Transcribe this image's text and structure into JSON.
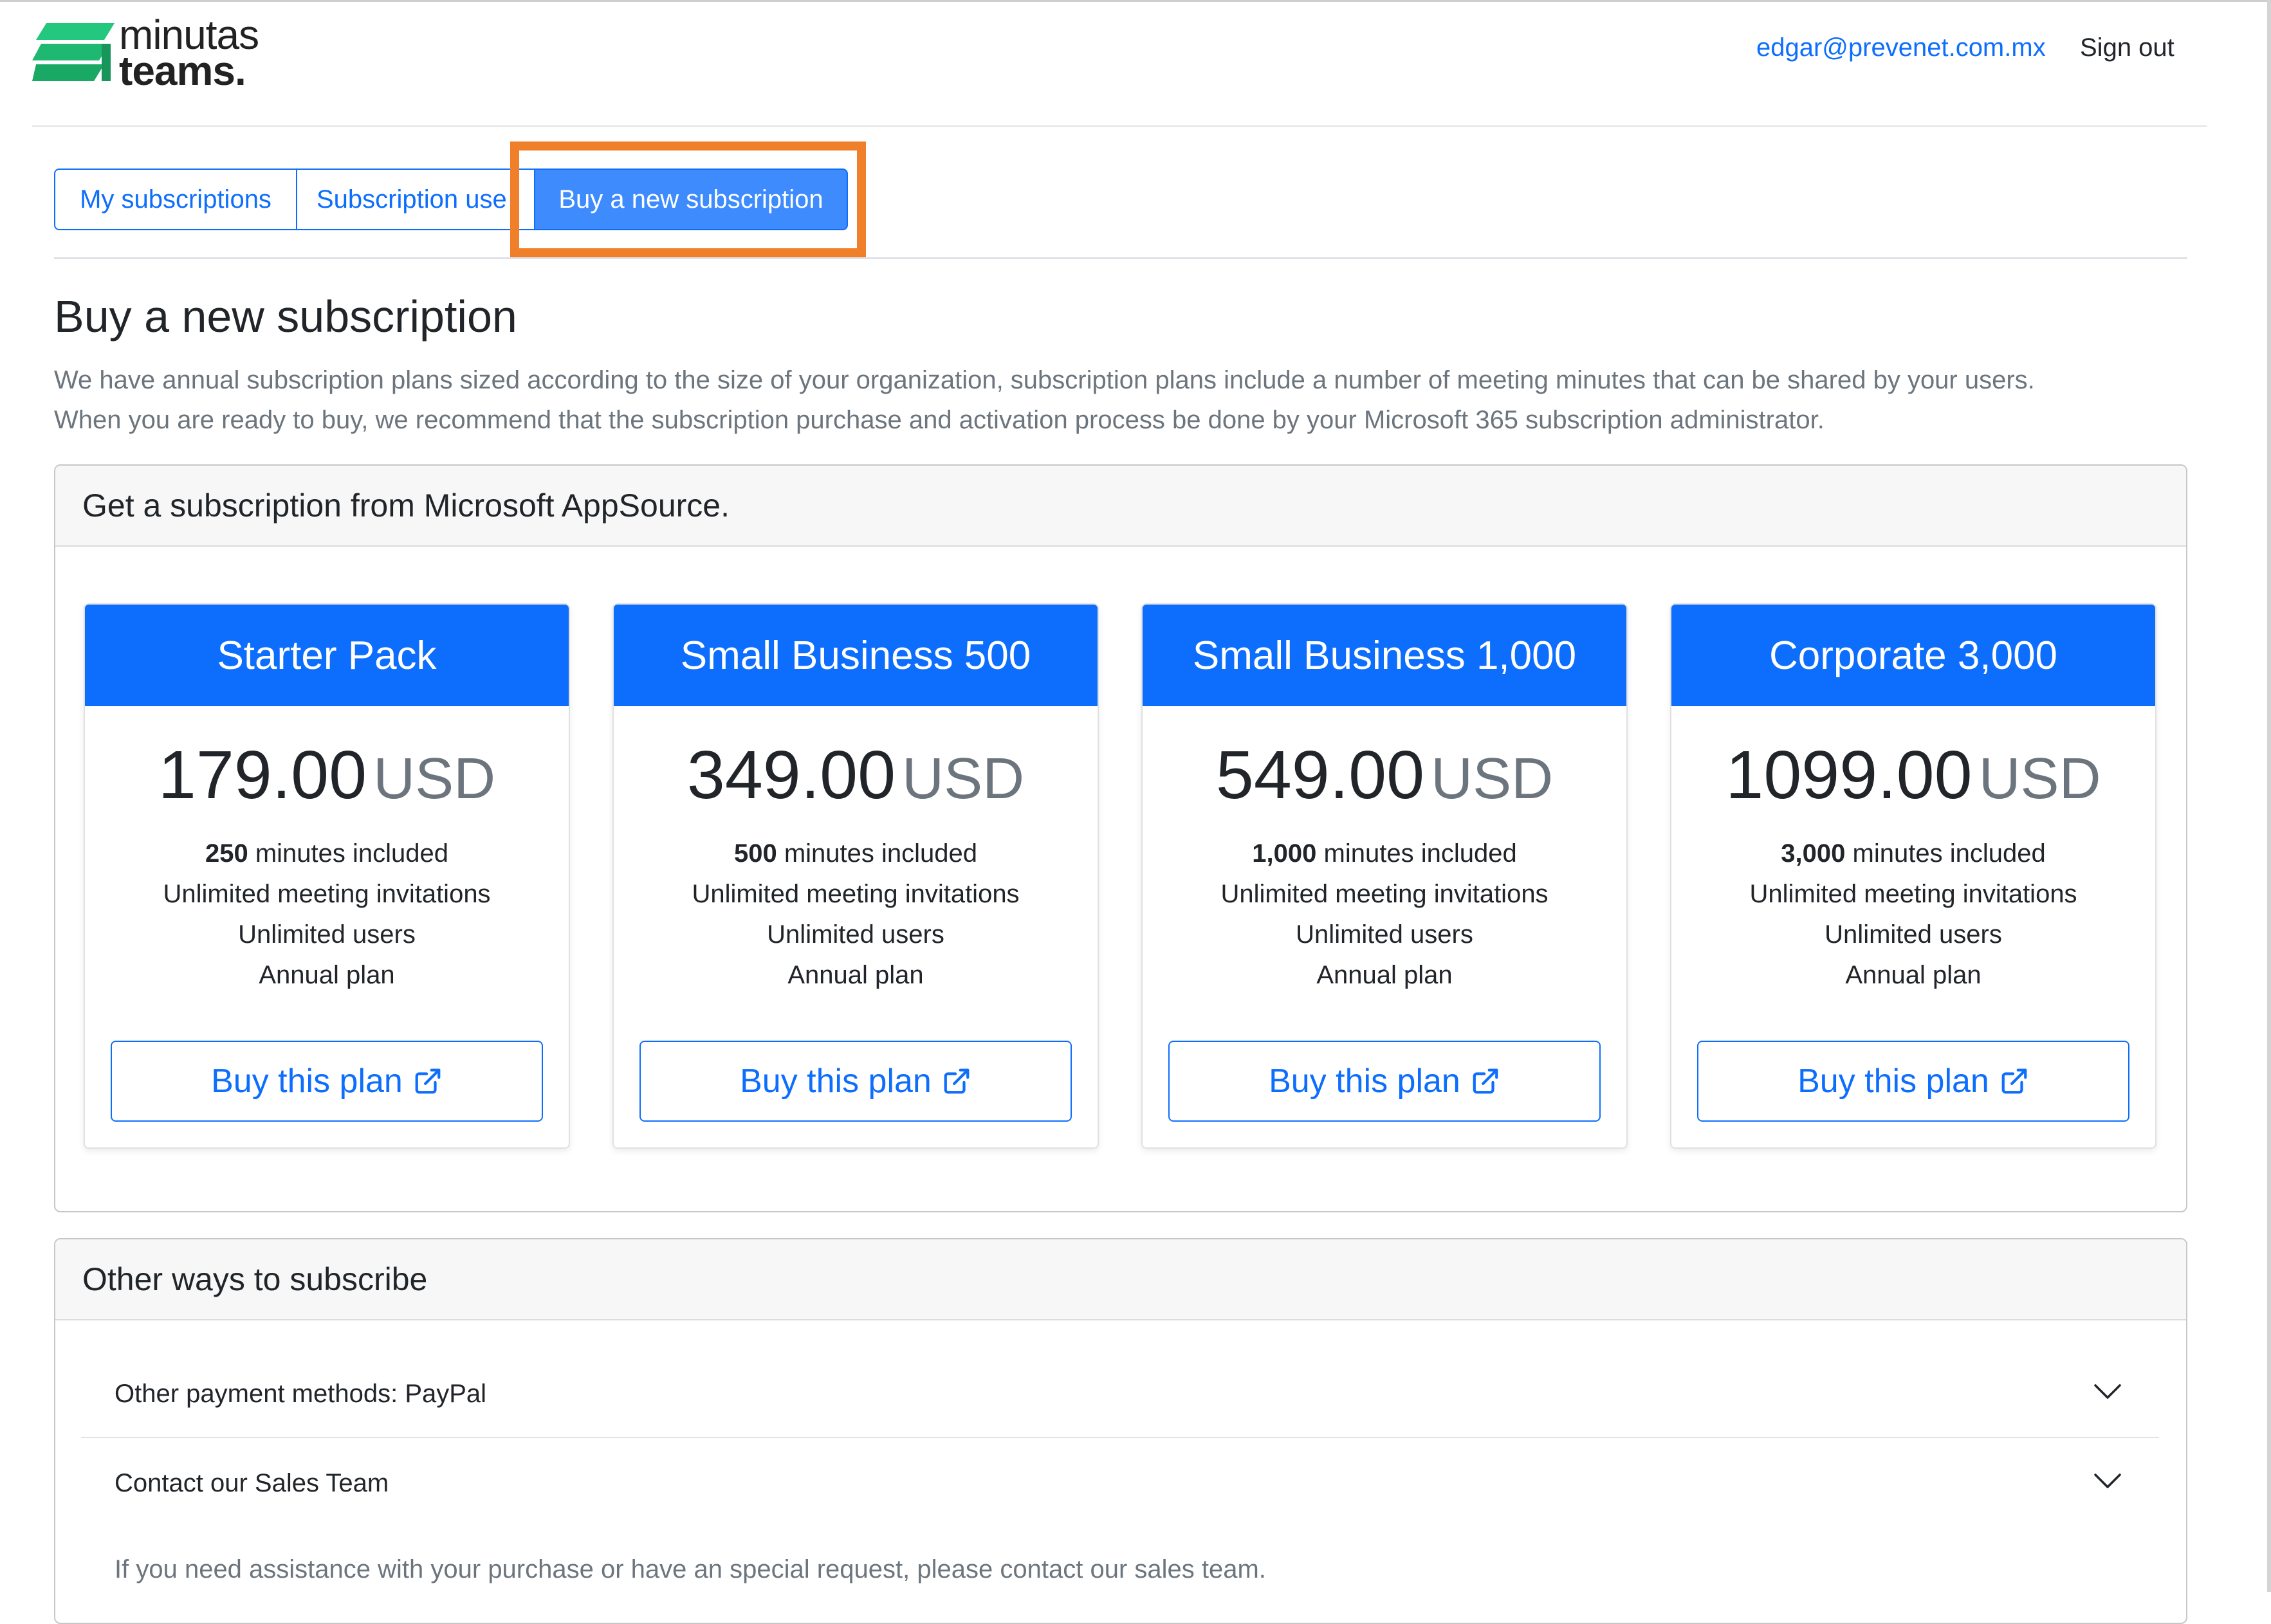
{
  "app": {
    "brand_line1": "minutas",
    "brand_line2": "teams.",
    "brand_color": "#23c77d"
  },
  "header": {
    "user_email": "edgar@prevenet.com.mx",
    "sign_out": "Sign out"
  },
  "tabs": [
    {
      "label": "My subscriptions",
      "active": false
    },
    {
      "label": "Subscription use",
      "active": false
    },
    {
      "label": "Buy a new subscription",
      "active": true
    }
  ],
  "page": {
    "title": "Buy a new subscription",
    "desc_line1": "We have annual subscription plans sized according to the size of your organization, subscription plans include a number of meeting minutes that can be shared by your users.",
    "desc_line2": "When you are ready to buy, we recommend that the subscription purchase and activation process be done by your Microsoft 365 subscription administrator."
  },
  "appsource": {
    "header": "Get a subscription from Microsoft AppSource.",
    "plans": [
      {
        "name": "Starter Pack",
        "price": "179.00",
        "currency": "USD",
        "minutes": "250",
        "minutes_label": "minutes included",
        "feat_invites": "Unlimited meeting invitations",
        "feat_users": "Unlimited users",
        "feat_plan": "Annual plan",
        "button": "Buy this plan"
      },
      {
        "name": "Small Business 500",
        "price": "349.00",
        "currency": "USD",
        "minutes": "500",
        "minutes_label": "minutes included",
        "feat_invites": "Unlimited meeting invitations",
        "feat_users": "Unlimited users",
        "feat_plan": "Annual plan",
        "button": "Buy this plan"
      },
      {
        "name": "Small Business 1,000",
        "price": "549.00",
        "currency": "USD",
        "minutes": "1,000",
        "minutes_label": "minutes included",
        "feat_invites": "Unlimited meeting invitations",
        "feat_users": "Unlimited users",
        "feat_plan": "Annual plan",
        "button": "Buy this plan"
      },
      {
        "name": "Corporate 3,000",
        "price": "1099.00",
        "currency": "USD",
        "minutes": "3,000",
        "minutes_label": "minutes included",
        "feat_invites": "Unlimited meeting invitations",
        "feat_users": "Unlimited users",
        "feat_plan": "Annual plan",
        "button": "Buy this plan"
      }
    ]
  },
  "other": {
    "header": "Other ways to subscribe",
    "items": [
      {
        "label": "Other payment methods: PayPal",
        "icon": "chevron-down-icon"
      },
      {
        "label": "Contact our Sales Team",
        "icon": "chevron-down-icon"
      }
    ],
    "sales_body": "If you need assistance with your purchase or have an special request, please contact our sales team."
  },
  "colors": {
    "primary": "#0d6efd",
    "active_tab": "#3d8bfd",
    "highlight": "#f07f2a",
    "muted_text": "#6c757d"
  }
}
